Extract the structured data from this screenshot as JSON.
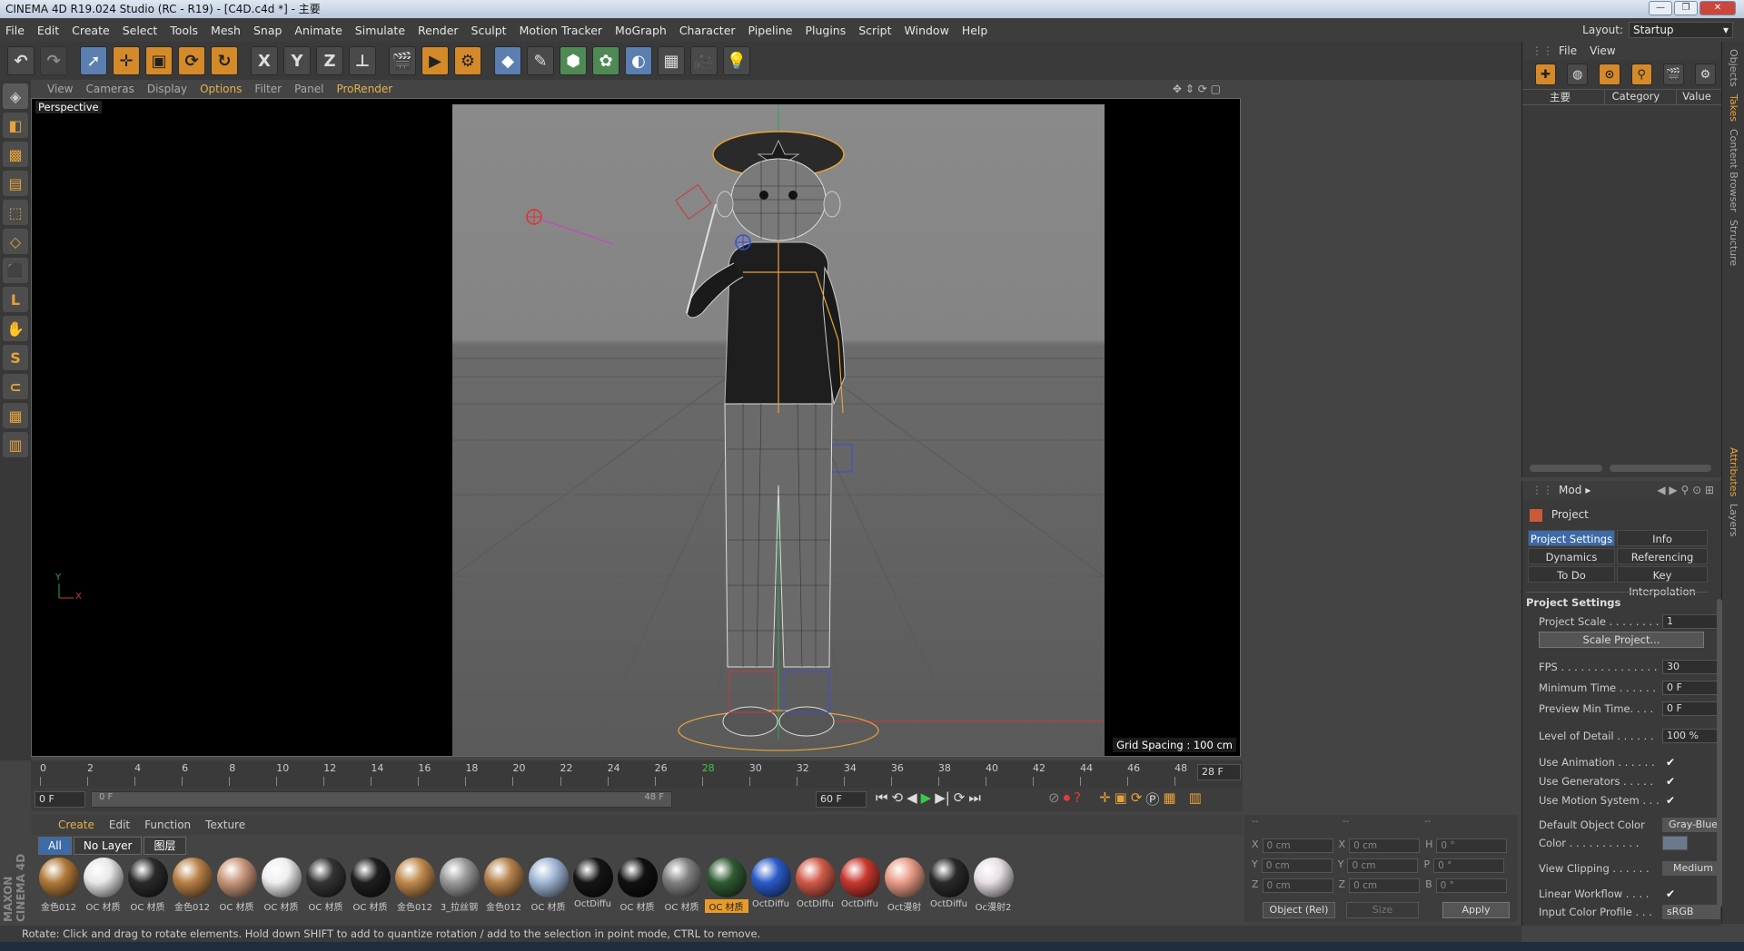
{
  "window": {
    "title": "CINEMA 4D R19.024 Studio (RC - R19) - [C4D.c4d *] - 主要"
  },
  "menu": [
    "File",
    "Edit",
    "Create",
    "Select",
    "Tools",
    "Mesh",
    "Snap",
    "Animate",
    "Simulate",
    "Render",
    "Sculpt",
    "Motion Tracker",
    "MoGraph",
    "Character",
    "Pipeline",
    "Plugins",
    "Script",
    "Window",
    "Help"
  ],
  "layout": {
    "label": "Layout:",
    "value": "Startup"
  },
  "viewport": {
    "menu": [
      "View",
      "Cameras",
      "Display",
      "Options",
      "Filter",
      "Panel",
      "ProRender"
    ],
    "label": "Perspective",
    "grid_spacing": "Grid Spacing : 100 cm",
    "axis_y": "Y",
    "axis_x": "X"
  },
  "timeline": {
    "ticks": [
      "0",
      "2",
      "4",
      "6",
      "8",
      "10",
      "12",
      "14",
      "16",
      "18",
      "20",
      "22",
      "24",
      "26",
      "28",
      "30",
      "32",
      "34",
      "36",
      "38",
      "40",
      "42",
      "44",
      "46",
      "48"
    ],
    "current_frame": "28 F",
    "start": "0 F",
    "slider_start": "0 F",
    "slider_end": "48 F",
    "end": "60 F"
  },
  "materials_panel": {
    "menu": [
      "Create",
      "Edit",
      "Function",
      "Texture"
    ],
    "filters": [
      "All",
      "No Layer",
      "图层"
    ],
    "items": [
      {
        "name": "金色012",
        "color": "#b07a3a"
      },
      {
        "name": "OC 材质",
        "color": "#e8e8e8"
      },
      {
        "name": "OC 材质",
        "color": "#2a2a2a"
      },
      {
        "name": "金色012",
        "color": "#b88045"
      },
      {
        "name": "OC 材质",
        "color": "#c8967a"
      },
      {
        "name": "OC 材质",
        "color": "#eeeeee"
      },
      {
        "name": "OC 材质",
        "color": "#333333"
      },
      {
        "name": "OC 材质",
        "color": "#1e1e1e"
      },
      {
        "name": "金色012",
        "color": "#c08a4e"
      },
      {
        "name": "3_拉丝钢",
        "color": "#9a9a9a"
      },
      {
        "name": "金色012",
        "color": "#b4824c"
      },
      {
        "name": "OC 材质",
        "color": "#9fb6d6"
      },
      {
        "name": "OctDiffu",
        "color": "#151515"
      },
      {
        "name": "OC 材质",
        "color": "#101010"
      },
      {
        "name": "OC 材质",
        "color": "#808080"
      },
      {
        "name": "OC 材质",
        "color": "#2f5a32"
      },
      {
        "name": "OctDiffu",
        "color": "#2a5bc8"
      },
      {
        "name": "OctDiffu",
        "color": "#d05a48"
      },
      {
        "name": "OctDiffu",
        "color": "#c8382e"
      },
      {
        "name": "Oct漫射",
        "color": "#e89c86"
      },
      {
        "name": "OctDiffu",
        "color": "#2a2a2a"
      },
      {
        "name": "Oc漫射2",
        "color": "#e6dfe6"
      }
    ],
    "selected_index": 15
  },
  "coordinates": {
    "headers": [
      "--",
      "--",
      "--"
    ],
    "rows": [
      {
        "a": "X",
        "av": "0 cm",
        "b": "X",
        "bv": "0 cm",
        "c": "H",
        "cv": "0 °"
      },
      {
        "a": "Y",
        "av": "0 cm",
        "b": "Y",
        "bv": "0 cm",
        "c": "P",
        "cv": "0 °"
      },
      {
        "a": "Z",
        "av": "0 cm",
        "b": "Z",
        "bv": "0 cm",
        "c": "B",
        "cv": "0 °"
      }
    ],
    "mode": "Object (Rel)",
    "size": "Size",
    "apply": "Apply"
  },
  "status": "Rotate: Click and drag to rotate elements. Hold down SHIFT to add to quantize rotation / add to the selection in point mode, CTRL to remove.",
  "objects_panel": {
    "menu": [
      "File",
      "View"
    ],
    "col_name": "主要",
    "col_category": "Category",
    "col_value": "Value"
  },
  "side_tabs": [
    "Objects",
    "Takes",
    "Content Browser",
    "Structure",
    "Attributes",
    "Layers"
  ],
  "attributes": {
    "mode": "Mod",
    "title": "Project",
    "tabs": [
      "Project Settings",
      "Info",
      "Dynamics",
      "Referencing",
      "To Do",
      "Key Interpolation"
    ],
    "section": "Project Settings",
    "project_scale_label": "Project Scale . . . . . . . .",
    "project_scale": "1",
    "scale_button": "Scale Project...",
    "fps_label": "FPS . . . . . . . . . . . . . . .",
    "fps": "30",
    "min_time_label": "Minimum Time . . . . . .",
    "min_time": "0 F",
    "preview_min_label": "Preview Min Time. . . .",
    "preview_min": "0 F",
    "lod_label": "Level of Detail . . . . . .",
    "lod": "100 %",
    "use_animation": "Use Animation . . . . . .",
    "use_generators": "Use Generators . . . . .",
    "use_motion": "Use Motion System . . .",
    "default_color_label": "Default Object Color",
    "default_color": "Gray-Blue",
    "color_label": "Color . . . . . . . . . . .",
    "view_clipping_label": "View Clipping . . . . . .",
    "view_clipping": "Medium",
    "linear_workflow": "Linear Workflow . . . .",
    "input_color_label": "Input Color Profile . . .",
    "input_color": "sRGB",
    "check": "✔"
  },
  "brand": "MAXON CINEMA 4D"
}
